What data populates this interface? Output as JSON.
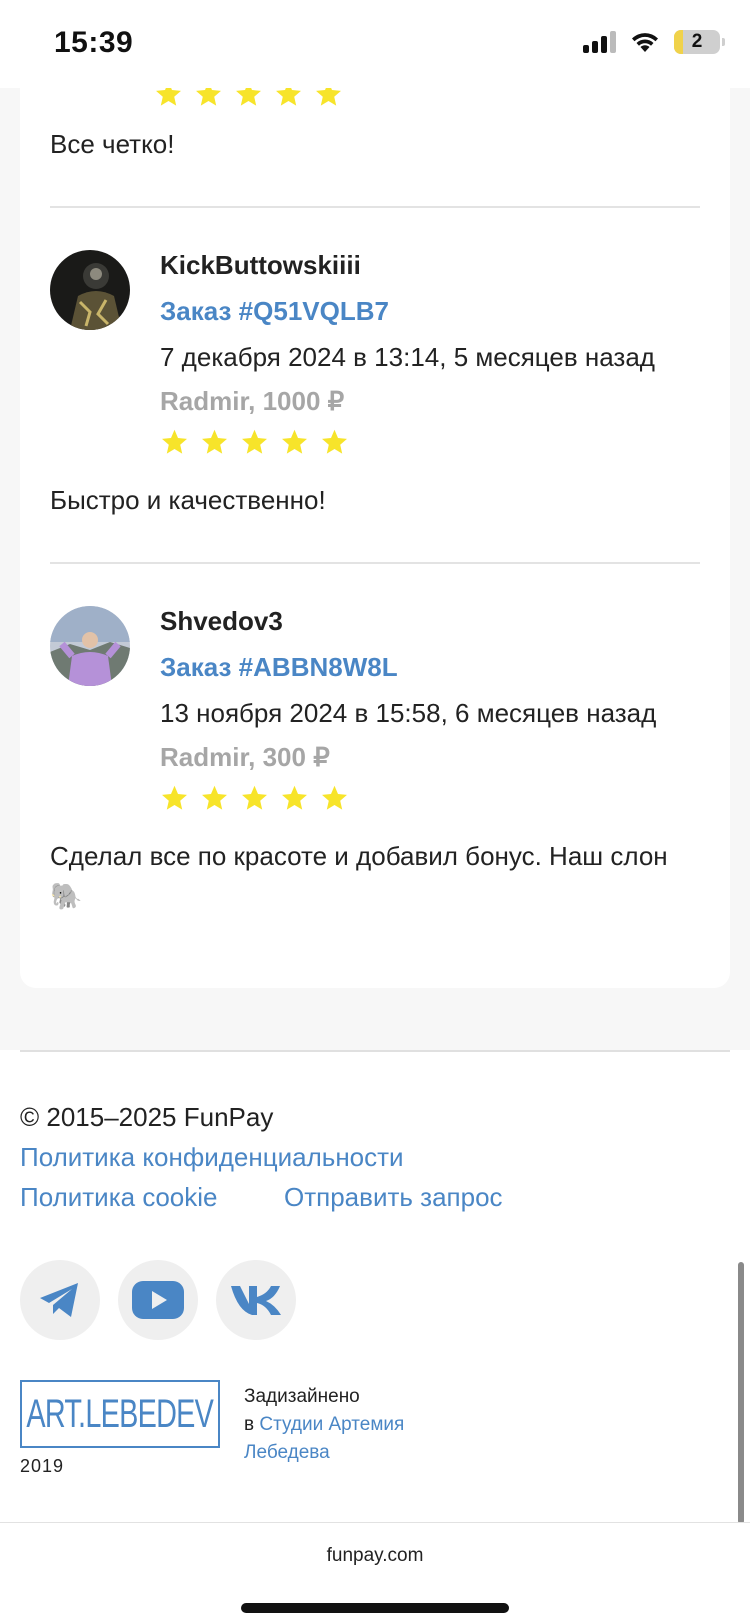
{
  "status_bar": {
    "time": "15:39",
    "battery": "2"
  },
  "colors": {
    "accent": "#4a86c5",
    "star": "#f7e42a",
    "muted": "#a6a6a6"
  },
  "reviews": [
    {
      "text": "Все четко!",
      "rating": 5
    },
    {
      "user": "KickButtowskiiii",
      "order": "Заказ #Q51VQLB7",
      "date": "7 декабря 2024 в 13:14, 5 месяцев назад",
      "server": "Radmir, 1000 ₽",
      "rating": 5,
      "text": "Быстро и качественно!"
    },
    {
      "user": "Shvedov3",
      "order": "Заказ #ABBN8W8L",
      "date": "13 ноября 2024 в 15:58, 6 месяцев назад",
      "server": "Radmir, 300 ₽",
      "rating": 5,
      "text": "Сделал все по красоте и добавил бонус. Наш слон 🐘"
    }
  ],
  "footer": {
    "copyright": "© 2015–2025 FunPay",
    "privacy_policy": "Политика конфиденциальности",
    "cookie_policy": "Политика cookie",
    "send_request": "Отправить запрос",
    "social_icons": [
      "telegram-icon",
      "youtube-icon",
      "vk-icon"
    ],
    "lebedev_logo": "ART.LEBEDEV",
    "lebedev_year": "2019",
    "designed_by": "Задизайнено",
    "designed_in": "в",
    "studio_link": "Студии Артемия Лебедева"
  },
  "browser": {
    "url": "funpay.com"
  }
}
